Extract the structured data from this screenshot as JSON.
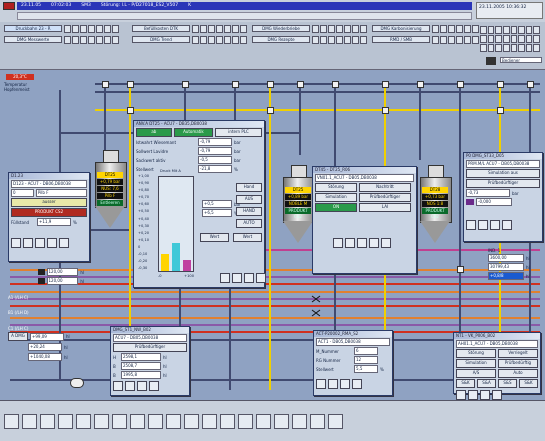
{
  "alarm_bar": {
    "date": "23.11.05",
    "time": "07:02:03",
    "source": "SM3",
    "message": "Störung: I.L - P/D27018_ES2_V507",
    "flag": "K"
  },
  "datetime": "23.11.2005 10:36:32",
  "navigation": {
    "top_row": [
      "Druckbahn 23 - R",
      "Befüllkosten DTK",
      "DMG Wiederbriebe",
      "DMG Karbonisierung"
    ],
    "bottom_row": [
      "DMG Messwerte",
      "DMG Trend",
      "DMG Rezepte",
      "RMD / SMB"
    ],
    "right_label": "Bediener"
  },
  "colors": {
    "alarm_blue": "#2a35b8",
    "pipe_yellow": "#f0d000",
    "pipe_red": "#d03020",
    "pipe_orange": "#e08030",
    "pipe_purple": "#8a5aa8",
    "pipe_dark": "#404a70",
    "pipe_magenta": "#c04090"
  },
  "temperature_label": "Temperatur Hopfenmeist",
  "temp_value": "20,3°C",
  "tanks": [
    {
      "id": "DT25",
      "v1": "+0,79 bar",
      "v2": "NUS: 7,6",
      "v3": "Pilb F",
      "status": "Entleeren"
    },
    {
      "id": "DT25",
      "v1": "+0,89 bar",
      "v2": "NOBLE M",
      "v3": "",
      "status": "PRODUKT CS2"
    },
    {
      "id": "DT28",
      "v1": "+0,73 bar",
      "v2": "NOS 1:8",
      "v3": "",
      "status": "PRODUKT CS2"
    }
  ],
  "window_main": {
    "title": "ANV.A DT25 - ACU7 - DB35,DB0038",
    "tabs": [
      "ab",
      "Automatik",
      "intern PLC"
    ],
    "rows": [
      {
        "label": "Istwahrt Wiesemant",
        "value": "-0,79",
        "unit": "bar"
      },
      {
        "label": "Sollwert Lavidre",
        "value": "-0,79",
        "unit": "bar"
      },
      {
        "label": "Sackwert aktiv",
        "value": "-0,5",
        "unit": "bar"
      },
      {
        "label": "Stellwert",
        "value": "-21,8",
        "unit": "%"
      }
    ],
    "scale": [
      "+1,00",
      "+0,90",
      "+0,80",
      "+0,70",
      "+0,60",
      "+0,50",
      "+0,40",
      "+0,30",
      "+0,20",
      "+0,10",
      "0",
      "-0,10",
      "-0,20",
      "-0,30"
    ],
    "bar_header": "Druck Mit A",
    "fields": [
      {
        "value": "+0,5",
        "unit": "bar"
      },
      {
        "value": "+6,5",
        "unit": "%"
      }
    ],
    "buttons": [
      "Hand",
      "AUS",
      "HAND",
      "AUTO",
      "Wert",
      "Wert"
    ],
    "bar_levels": {
      "yellow_pct": 18,
      "cyan_pct": 30,
      "magenta_pct": 12
    },
    "axis_bottom": [
      "-0",
      "+100"
    ]
  },
  "window_left": {
    "title": "D1.23",
    "subtitle": "D123 - ACU7 - DB06,DB0038",
    "field1": "0",
    "field2": "Pilb F",
    "status": "ausser",
    "product": "PRODUKT CS2",
    "extra_label": "Füllstand",
    "extra_value": "+11,9",
    "extra_unit": "%"
  },
  "window_center_right": {
    "title": "DT45 - DT25_R06",
    "subtitle": "VN01.1_ACU7 - DB05,DB0038",
    "rows": [
      [
        "Störung",
        "Nachtritt"
      ],
      [
        "Simulation",
        "Prüfbedürftiger"
      ]
    ],
    "buttons": [
      "ON",
      "LAI"
    ]
  },
  "window_right": {
    "title": "P0 DMG_ST33_D05",
    "subtitle": "PRM.M/L ACU7 - DB05,DB0038",
    "label1": "Simulation aus",
    "label2": "Prüfbedürftiger",
    "value": "-0,73",
    "unit": "bar",
    "value2": "-0,000"
  },
  "window_bottom_left": {
    "title": "DMG_ST1_NW_B02",
    "subtitle": "ACU7 - DB05,DB0038",
    "label": "Prüfbedürftiger",
    "values": [
      {
        "name": "H",
        "value": "2598,1",
        "unit": "hl"
      },
      {
        "name": "B",
        "value": "2508,7",
        "unit": "hl"
      },
      {
        "name": "B",
        "value": "1995,8",
        "unit": "hl"
      }
    ]
  },
  "window_bottom_mid": {
    "title": "ACT-P20002_RMA_S2",
    "subtitle": "ACT1 - DB05,DB0038",
    "rows": [
      {
        "label": "M_Nummer",
        "value": "6"
      },
      {
        "label": "RG Nummer",
        "value": "12"
      },
      {
        "label": "Stellwert",
        "value": "5,5",
        "unit": "%"
      }
    ]
  },
  "window_bottom_right": {
    "title": "NT1 - VK_P006_B02",
    "subtitle": "AH01.1_ACU7 - DB05,DB0038",
    "rows": [
      [
        "Störung",
        "Verriegelt"
      ],
      [
        "Simulation",
        "Prüfbedürftig"
      ],
      [
        "A/S",
        "Auto"
      ]
    ],
    "buttons": [
      "S&K",
      "S&A",
      "S&S",
      "S&K"
    ]
  },
  "left_tags": [
    {
      "label": "BX 1",
      "value": "120,00",
      "unit": "hl"
    },
    {
      "label": "BX 2",
      "value": "120,00",
      "unit": "hl"
    }
  ],
  "right_tags": [
    {
      "label": "IND. 1",
      "value": "3600,00",
      "unit": "hl"
    },
    {
      "label": "IND. 2",
      "value": "30799,43",
      "unit": "hl"
    },
    {
      "label": "IND. 3",
      "value": "+0,8/8",
      "unit": "hl"
    }
  ],
  "left_line_labels": [
    "A1 (/LH C)",
    "B1 (/LH D)",
    "C1 (/LH C)"
  ],
  "bottom_left_tags": [
    {
      "label": "A DMG",
      "value": "+99,09",
      "unit": "hl"
    },
    {
      "label": "",
      "value": "+20,24",
      "unit": "hl"
    },
    {
      "label": "",
      "value": "+1040,08",
      "unit": "hl"
    }
  ],
  "toolbar_icons": [
    "back-icon",
    "play-icon",
    "lock-icon",
    "print-icon",
    "window-icon",
    "chart-icon",
    "list-icon",
    "alarm-icon",
    "tool-icon",
    "table-icon",
    "settings-icon",
    "valve-icon",
    "user-icon",
    "pump-icon",
    "trend-icon",
    "clock-icon",
    "help-icon",
    "key-icon",
    "exit-icon"
  ]
}
